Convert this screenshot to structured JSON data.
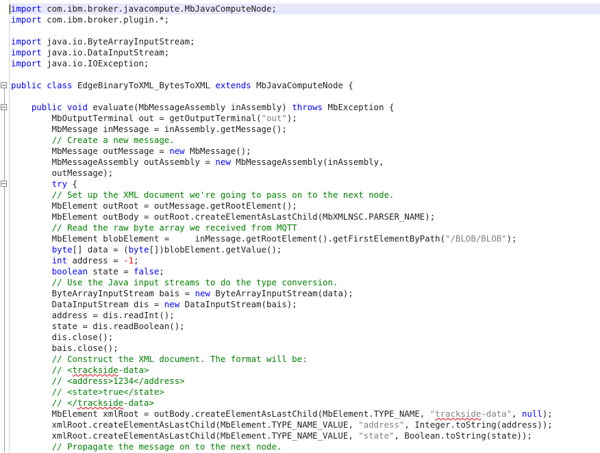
{
  "editor": {
    "lines": [
      [
        {
          "t": "import",
          "c": "kw"
        },
        {
          "t": " com.ibm.broker.javacompute.MbJavaComputeNode;",
          "c": ""
        }
      ],
      [
        {
          "t": "import",
          "c": "kw"
        },
        {
          "t": " com.ibm.broker.plugin.*;",
          "c": ""
        }
      ],
      [],
      [
        {
          "t": "import",
          "c": "kw"
        },
        {
          "t": " java.io.ByteArrayInputStream;",
          "c": ""
        }
      ],
      [
        {
          "t": "import",
          "c": "kw"
        },
        {
          "t": " java.io.DataInputStream;",
          "c": ""
        }
      ],
      [
        {
          "t": "import",
          "c": "kw"
        },
        {
          "t": " java.io.IOException;",
          "c": ""
        }
      ],
      [],
      [
        {
          "t": "public class",
          "c": "kw"
        },
        {
          "t": " EdgeBinaryToXML_BytesToXML ",
          "c": ""
        },
        {
          "t": "extends",
          "c": "kw"
        },
        {
          "t": " MbJavaComputeNode {",
          "c": ""
        }
      ],
      [],
      [
        {
          "t": "    ",
          "c": ""
        },
        {
          "t": "public void",
          "c": "kw"
        },
        {
          "t": " evaluate(MbMessageAssembly inAssembly) ",
          "c": ""
        },
        {
          "t": "throws",
          "c": "kw"
        },
        {
          "t": " MbException {",
          "c": ""
        }
      ],
      [
        {
          "t": "        MbOutputTerminal out = getOutputTerminal(",
          "c": ""
        },
        {
          "t": "\"out\"",
          "c": "st"
        },
        {
          "t": ");",
          "c": ""
        }
      ],
      [
        {
          "t": "        MbMessage inMessage = inAssembly.getMessage();",
          "c": ""
        }
      ],
      [
        {
          "t": "        ",
          "c": ""
        },
        {
          "t": "// Create a new message.",
          "c": "cm"
        }
      ],
      [
        {
          "t": "        MbMessage outMessage = ",
          "c": ""
        },
        {
          "t": "new",
          "c": "kw"
        },
        {
          "t": " MbMessage();",
          "c": ""
        }
      ],
      [
        {
          "t": "        MbMessageAssembly outAssembly = ",
          "c": ""
        },
        {
          "t": "new",
          "c": "kw"
        },
        {
          "t": " MbMessageAssembly(inAssembly,",
          "c": ""
        }
      ],
      [
        {
          "t": "        outMessage);",
          "c": ""
        }
      ],
      [
        {
          "t": "        ",
          "c": ""
        },
        {
          "t": "try",
          "c": "kw"
        },
        {
          "t": " {",
          "c": ""
        }
      ],
      [
        {
          "t": "        ",
          "c": ""
        },
        {
          "t": "// Set up the XML document we're going to pass on to the next node.",
          "c": "cm"
        }
      ],
      [
        {
          "t": "        MbElement outRoot = outMessage.getRootElement();",
          "c": ""
        }
      ],
      [
        {
          "t": "        MbElement outBody = outRoot.createElementAsLastChild(MbXMLNSC.PARSER_NAME);",
          "c": ""
        }
      ],
      [
        {
          "t": "        ",
          "c": ""
        },
        {
          "t": "// Read the raw byte array we received from MQTT",
          "c": "cm"
        }
      ],
      [
        {
          "t": "        MbElement blobElement =     inMessage.getRootElement().getFirstElementByPath(",
          "c": ""
        },
        {
          "t": "\"/BLOB/BLOB\"",
          "c": "st"
        },
        {
          "t": ");",
          "c": ""
        }
      ],
      [
        {
          "t": "        ",
          "c": ""
        },
        {
          "t": "byte",
          "c": "kw"
        },
        {
          "t": "[] data = (",
          "c": ""
        },
        {
          "t": "byte",
          "c": "kw"
        },
        {
          "t": "[])blobElement.getValue();",
          "c": ""
        }
      ],
      [
        {
          "t": "        ",
          "c": ""
        },
        {
          "t": "int",
          "c": "kw"
        },
        {
          "t": " address = ",
          "c": ""
        },
        {
          "t": "-1",
          "c": "nu"
        },
        {
          "t": ";",
          "c": ""
        }
      ],
      [
        {
          "t": "        ",
          "c": ""
        },
        {
          "t": "boolean",
          "c": "kw"
        },
        {
          "t": " state = ",
          "c": ""
        },
        {
          "t": "false",
          "c": "kw"
        },
        {
          "t": ";",
          "c": ""
        }
      ],
      [
        {
          "t": "        ",
          "c": ""
        },
        {
          "t": "// Use the Java input streams to do the type conversion.",
          "c": "cm"
        }
      ],
      [
        {
          "t": "        ByteArrayInputStream bais = ",
          "c": ""
        },
        {
          "t": "new",
          "c": "kw"
        },
        {
          "t": " ByteArrayInputStream(data);",
          "c": ""
        }
      ],
      [
        {
          "t": "        DataInputStream dis = ",
          "c": ""
        },
        {
          "t": "new",
          "c": "kw"
        },
        {
          "t": " DataInputStream(bais);",
          "c": ""
        }
      ],
      [
        {
          "t": "        address = dis.readInt();",
          "c": ""
        }
      ],
      [
        {
          "t": "        state = dis.readBoolean();",
          "c": ""
        }
      ],
      [
        {
          "t": "        dis.close();",
          "c": ""
        }
      ],
      [
        {
          "t": "        bais.close();",
          "c": ""
        }
      ],
      [
        {
          "t": "        ",
          "c": ""
        },
        {
          "t": "// Construct the XML document. The format will be:",
          "c": "cm"
        }
      ],
      [
        {
          "t": "        ",
          "c": ""
        },
        {
          "t": "// <",
          "c": "cm"
        },
        {
          "t": "trackside",
          "c": "cm sp"
        },
        {
          "t": "-data>",
          "c": "cm"
        }
      ],
      [
        {
          "t": "        ",
          "c": ""
        },
        {
          "t": "// <address>1234</address>",
          "c": "cm"
        }
      ],
      [
        {
          "t": "        ",
          "c": ""
        },
        {
          "t": "// <state>true</state>",
          "c": "cm"
        }
      ],
      [
        {
          "t": "        ",
          "c": ""
        },
        {
          "t": "// </",
          "c": "cm"
        },
        {
          "t": "trackside",
          "c": "cm sp"
        },
        {
          "t": "-data>",
          "c": "cm"
        }
      ],
      [
        {
          "t": "        MbElement xmlRoot = outBody.createElementAsLastChild(MbElement.TYPE_NAME, ",
          "c": ""
        },
        {
          "t": "\"",
          "c": "st"
        },
        {
          "t": "trackside",
          "c": "st sp"
        },
        {
          "t": "-data\"",
          "c": "st"
        },
        {
          "t": ", ",
          "c": ""
        },
        {
          "t": "null",
          "c": "kw"
        },
        {
          "t": ");",
          "c": ""
        }
      ],
      [
        {
          "t": "        xmlRoot.createElementAsLastChild(MbElement.TYPE_NAME_VALUE, ",
          "c": ""
        },
        {
          "t": "\"address\"",
          "c": "st"
        },
        {
          "t": ", Integer.toString(address));",
          "c": ""
        }
      ],
      [
        {
          "t": "        xmlRoot.createElementAsLastChild(MbElement.TYPE_NAME_VALUE, ",
          "c": ""
        },
        {
          "t": "\"state\"",
          "c": "st"
        },
        {
          "t": ", Boolean.toString(state));",
          "c": ""
        }
      ],
      [
        {
          "t": "        ",
          "c": ""
        },
        {
          "t": "// Propagate the message on to the next node.",
          "c": "cm"
        }
      ]
    ],
    "current_line": 0,
    "folds": [
      {
        "line": 7,
        "end": 41
      },
      {
        "line": 9,
        "end": 41
      },
      {
        "line": 16,
        "end": 41
      }
    ],
    "colors": {
      "keyword": "#0000ff",
      "comment": "#008000",
      "string": "#808080",
      "number": "#ff0000",
      "text": "#222222",
      "current_line": "#e8e8ff"
    }
  }
}
